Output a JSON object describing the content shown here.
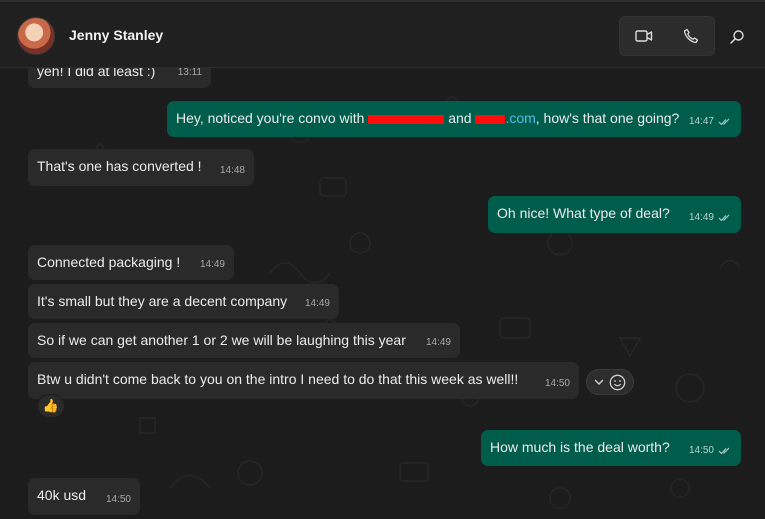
{
  "header": {
    "contact_name": "Jenny Stanley",
    "video_icon": "video-camera-icon",
    "call_icon": "phone-icon",
    "search_icon": "search-icon"
  },
  "messages": [
    {
      "direction": "in",
      "text": "yeh! I did at least :)",
      "time": "13:11"
    },
    {
      "direction": "out",
      "text_a": "Hey, noticed you're convo with ",
      "text_b": "and ",
      "link_suffix": ".com",
      "text_c": ", how's that one going?",
      "time": "14:47",
      "status": "read"
    },
    {
      "direction": "in",
      "text": "That's one has converted !",
      "time": "14:48"
    },
    {
      "direction": "out",
      "text": "Oh nice! What type of deal?",
      "time": "14:49",
      "status": "read"
    },
    {
      "direction": "in",
      "text": "Connected packaging !",
      "time": "14:49"
    },
    {
      "direction": "in",
      "text": "It's small but they are a decent company",
      "time": "14:49"
    },
    {
      "direction": "in",
      "text": "So if we can get another 1 or 2 we will be laughing this year",
      "time": "14:49"
    },
    {
      "direction": "in",
      "text": "Btw u didn't come back to you on the intro I need to do that this week as well!!",
      "time": "14:50",
      "reaction": "👍"
    },
    {
      "direction": "out",
      "text": "How much is the deal worth?",
      "time": "14:50",
      "status": "read"
    },
    {
      "direction": "in",
      "text": "40k usd",
      "time": "14:50"
    }
  ],
  "colors": {
    "incoming_bubble": "#2a2a2a",
    "outgoing_bubble": "#005c4b",
    "link": "#53bdeb",
    "redaction": "#ff0d0d"
  }
}
